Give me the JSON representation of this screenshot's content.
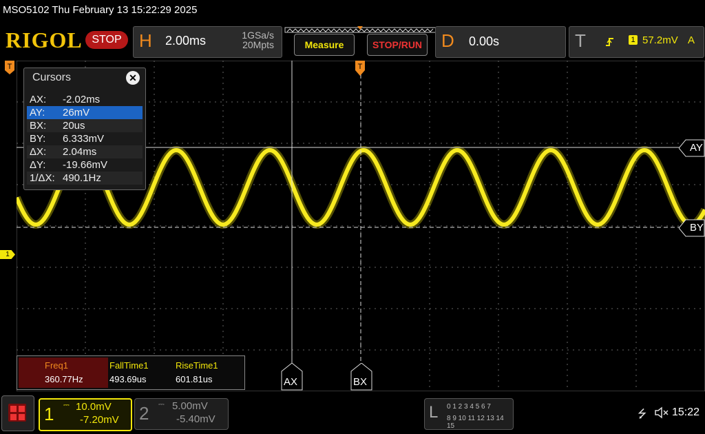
{
  "header": {
    "title": "MSO5102  Thu February 13 15:22:29 2025",
    "logo": "RIGOL",
    "run_state": "STOP"
  },
  "horizontal": {
    "letter": "H",
    "timebase": "2.00ms",
    "sample_rate": "1GSa/s",
    "memory_depth": "20Mpts"
  },
  "buttons": {
    "measure": "Measure",
    "stop_run": "STOP/RUN"
  },
  "delay": {
    "letter": "D",
    "value": "0.00s"
  },
  "trigger": {
    "letter": "T",
    "channel": "1",
    "level": "57.2mV",
    "mode": "A"
  },
  "cursors": {
    "title": "Cursors",
    "close": "✕",
    "rows": [
      {
        "key": "AX:",
        "value": "-2.02ms"
      },
      {
        "key": "AY:",
        "value": "26mV"
      },
      {
        "key": "BX:",
        "value": "20us"
      },
      {
        "key": "BY:",
        "value": "6.333mV"
      },
      {
        "key": "ΔX:",
        "value": "2.04ms"
      },
      {
        "key": "ΔY:",
        "value": "-19.66mV"
      },
      {
        "key": "1/ΔX:",
        "value": "490.1Hz"
      }
    ]
  },
  "cursor_labels": {
    "ax": "AX",
    "bx": "BX",
    "ay": "AY",
    "by": "BY"
  },
  "channel_marker": "1",
  "measurements": [
    {
      "name": "Freq1",
      "value": "360.77Hz"
    },
    {
      "name": "FallTime1",
      "value": "493.69us"
    },
    {
      "name": "RiseTime1",
      "value": "601.81us"
    }
  ],
  "channel1": {
    "number": "1",
    "scale": "10.0mV",
    "offset": "-7.20mV"
  },
  "channel2": {
    "number": "2",
    "scale": "5.00mV",
    "offset": "-5.40mV"
  },
  "logic": {
    "letter": "L",
    "row1": "0 1 2 3  4 5 6 7",
    "row2": "8 9 10 11 12 13 14 15"
  },
  "status": {
    "time": "15:22"
  },
  "colors": {
    "ch1": "#f2e60a",
    "accent": "#f08a1e",
    "stop": "#b51818"
  }
}
